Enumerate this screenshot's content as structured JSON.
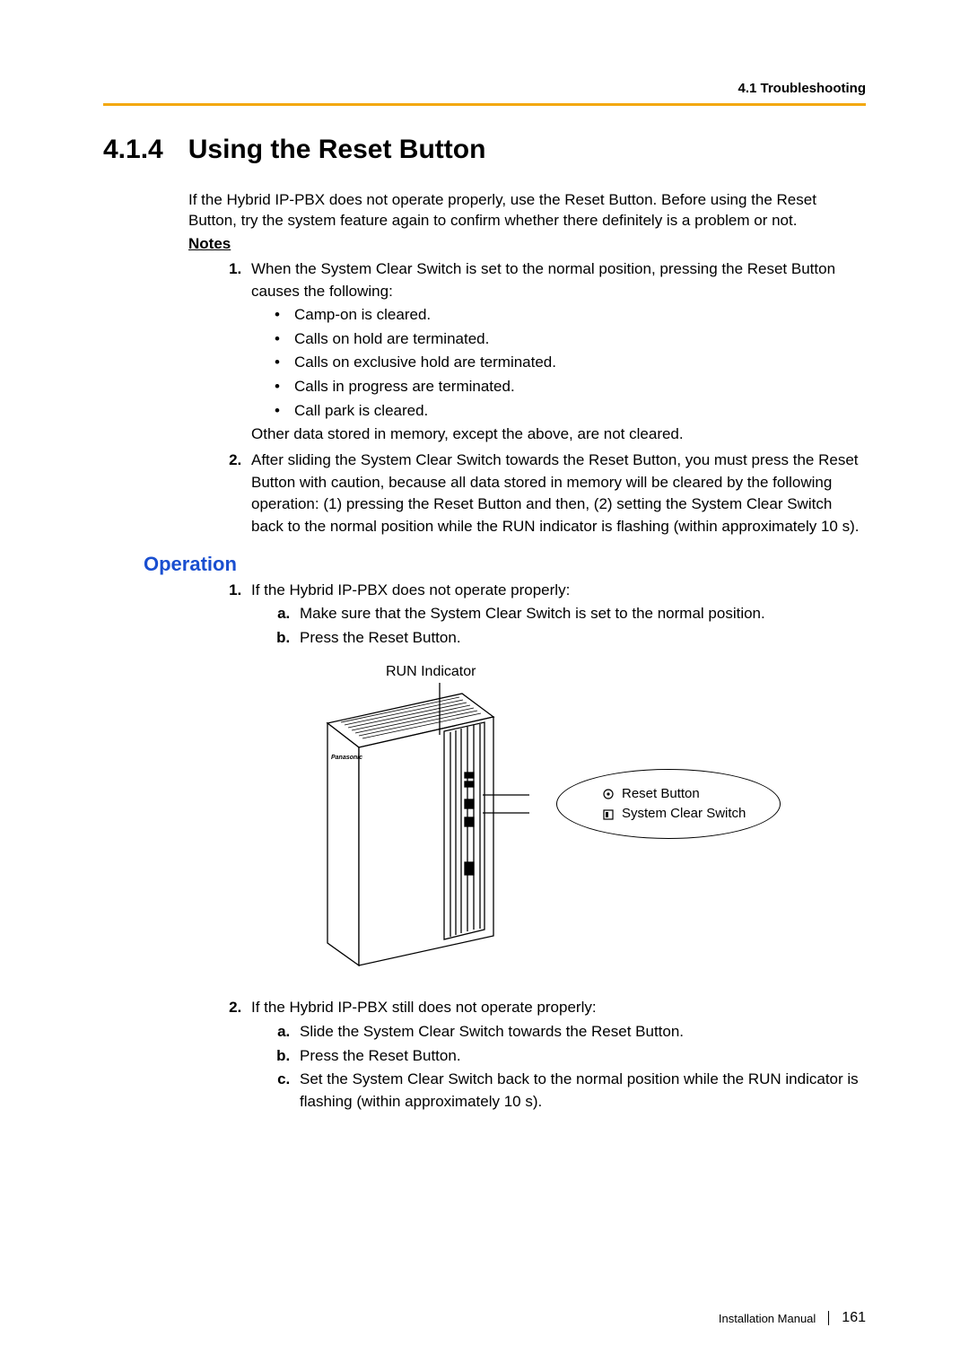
{
  "running_head": "4.1 Troubleshooting",
  "section_number": "4.1.4",
  "section_title": "Using the Reset Button",
  "intro": "If the Hybrid IP-PBX does not operate properly, use the Reset Button. Before using the Reset Button, try the system feature again to confirm whether there definitely is a problem or not.",
  "notes_head": "Notes",
  "note1_lead": "When the System Clear Switch is set to the normal position, pressing the Reset Button causes the following:",
  "note1_bullets": {
    "b1": "Camp-on is cleared.",
    "b2": "Calls on hold are terminated.",
    "b3": "Calls on exclusive hold are terminated.",
    "b4": "Calls in progress are terminated.",
    "b5": "Call park is cleared."
  },
  "note1_other": "Other data stored in memory, except the above, are not cleared.",
  "note2": "After sliding the System Clear Switch towards the Reset Button, you must press the Reset Button with caution, because all data stored in memory will be cleared by the following operation: (1) pressing the Reset Button and then, (2) setting the System Clear Switch back to the normal position while the RUN indicator is flashing (within approximately 10 s).",
  "operation_head": "Operation",
  "op1_lead": "If the Hybrid IP-PBX does not operate properly:",
  "op1_sub": {
    "a": "Make sure that the System Clear Switch is set to the normal position.",
    "b": "Press the Reset Button."
  },
  "figure": {
    "run_indicator": "RUN Indicator",
    "reset_button": "Reset Button",
    "system_clear_switch": "System Clear Switch",
    "brand": "Panasonic"
  },
  "op2_lead": "If the Hybrid IP-PBX still does not operate properly:",
  "op2_sub": {
    "a": "Slide the System Clear Switch towards the Reset Button.",
    "b": "Press the Reset Button.",
    "c": "Set the System Clear Switch back to the normal position while the RUN indicator is flashing (within approximately 10 s)."
  },
  "footer_title": "Installation Manual",
  "page_number": "161"
}
